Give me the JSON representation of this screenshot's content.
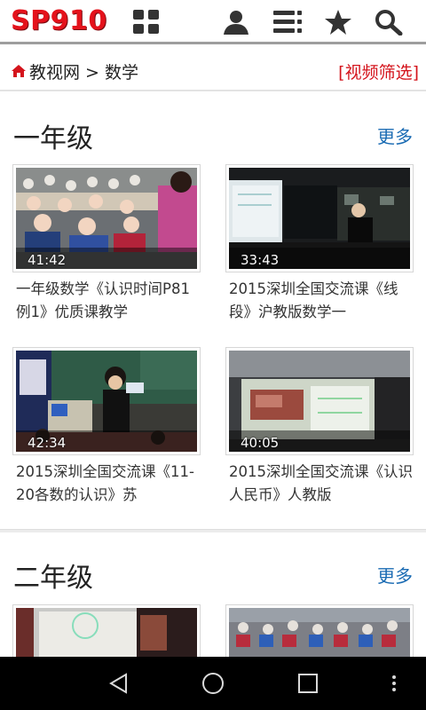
{
  "header": {
    "logo_text": "SP910",
    "icons": [
      "grid-icon",
      "user-icon",
      "list-icon",
      "star-icon",
      "search-icon"
    ],
    "brand_color": "#e4121b"
  },
  "breadcrumb": {
    "path": "教视网 > 数学",
    "filter_label": "[视频筛选]"
  },
  "sections": [
    {
      "title": "一年级",
      "more_label": "更多",
      "videos": [
        {
          "duration": "41:42",
          "title": "一年级数学《认识时间P81例1》优质课教学"
        },
        {
          "duration": "33:43",
          "title": "2015深圳全国交流课《线段》沪教版数学一"
        },
        {
          "duration": "42:34",
          "title": "2015深圳全国交流课《11-20各数的认识》苏"
        },
        {
          "duration": "40:05",
          "title": "2015深圳全国交流课《认识人民币》人教版"
        }
      ]
    },
    {
      "title": "二年级",
      "more_label": "更多",
      "videos": [
        {
          "duration": "",
          "title": ""
        },
        {
          "duration": "",
          "title": ""
        }
      ]
    }
  ],
  "navbar": {
    "icons": [
      "back-icon",
      "home-icon",
      "recents-icon",
      "menu-icon"
    ]
  }
}
